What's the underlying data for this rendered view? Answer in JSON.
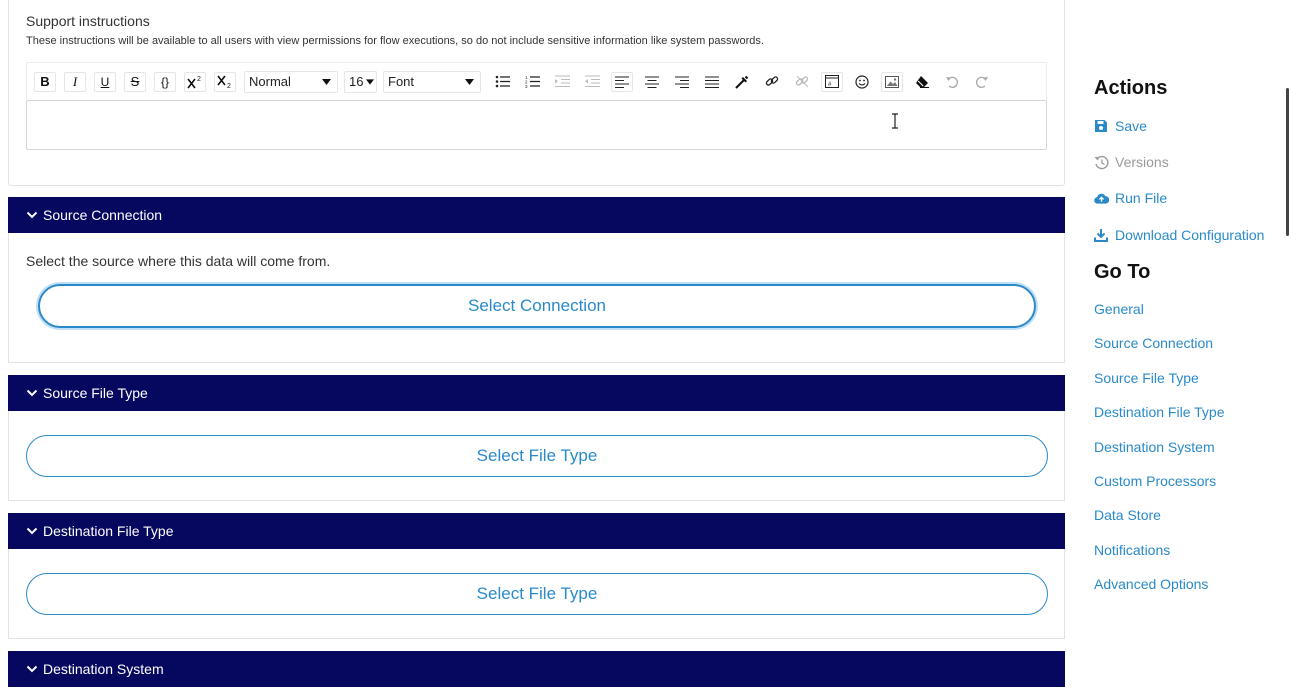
{
  "support": {
    "title": "Support instructions",
    "description": "These instructions will be available to all users with view permissions for flow executions, so do not include sensitive information like system passwords."
  },
  "toolbar": {
    "bold": "B",
    "italic": "I",
    "underline": "U",
    "strike": "S",
    "code": "{}",
    "format": "Normal",
    "size": "16",
    "font": "Font"
  },
  "sections": {
    "source_connection": {
      "title": "Source Connection",
      "description": "Select the source where this data will come from.",
      "button": "Select Connection"
    },
    "source_file_type": {
      "title": "Source File Type",
      "button": "Select File Type"
    },
    "destination_file_type": {
      "title": "Destination File Type",
      "button": "Select File Type"
    },
    "destination_system": {
      "title": "Destination System"
    }
  },
  "sidebar": {
    "actions_heading": "Actions",
    "actions": [
      {
        "label": "Save",
        "icon": "save-icon"
      },
      {
        "label": "Versions",
        "icon": "history-icon"
      },
      {
        "label": "Run File",
        "icon": "cloud-upload-icon"
      },
      {
        "label": "Download Configuration",
        "icon": "download-icon"
      }
    ],
    "goto_heading": "Go To",
    "goto": [
      "General",
      "Source Connection",
      "Source File Type",
      "Destination File Type",
      "Destination System",
      "Custom Processors",
      "Data Store",
      "Notifications",
      "Advanced Options"
    ]
  },
  "colors": {
    "header_bg": "#06085f",
    "link": "#2a8ac9",
    "disabled": "#9a9a9a"
  }
}
